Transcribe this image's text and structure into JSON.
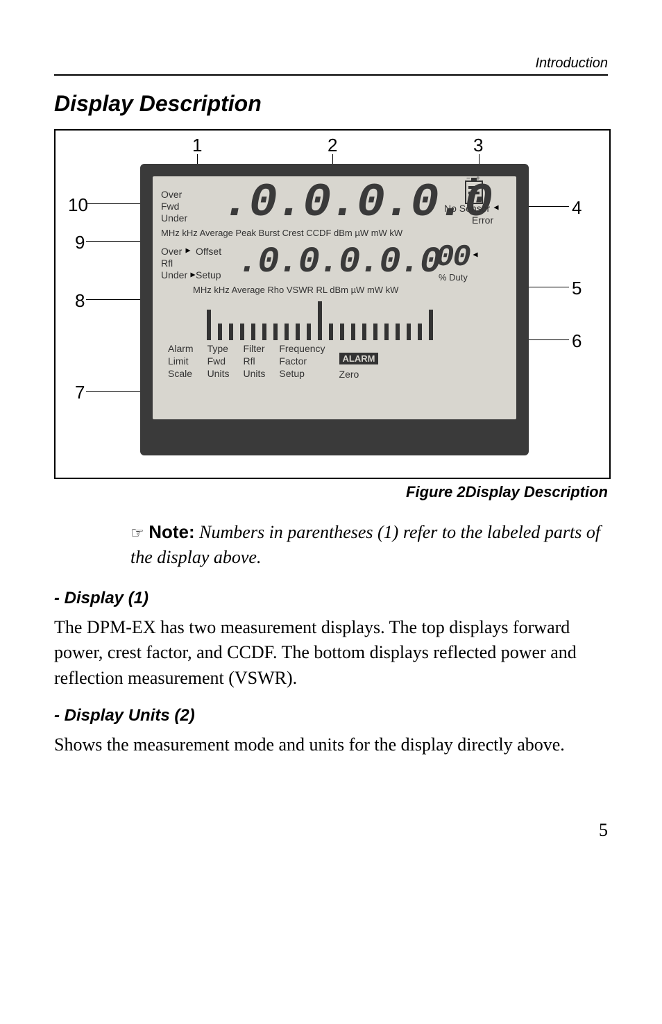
{
  "header": {
    "right": "Introduction"
  },
  "section_title": "Display Description",
  "figure": {
    "callouts": [
      "1",
      "2",
      "3",
      "4",
      "5",
      "6",
      "7",
      "8",
      "9",
      "10"
    ],
    "top": {
      "words": {
        "over": "Over",
        "fwd": "Fwd",
        "under": "Under"
      },
      "digits": ".0.0.0.0.0",
      "right": {
        "no_sensor": "No Sensor",
        "error": "Error"
      },
      "units_strip": "MHz kHz Average Peak Burst Crest CCDF dBm µW mW kW"
    },
    "bottom": {
      "words": {
        "over": "Over",
        "offset": "Offset",
        "rfl": "Rfl",
        "under": "Under",
        "setup": "Setup"
      },
      "digits": ".0.0.0.0.0",
      "duty_digits": "00",
      "duty_label": "% Duty",
      "units_strip": "MHz kHz Average Rho VSWR RL dBm µW mW kW"
    },
    "battery": {
      "minus": "−",
      "plus": "+"
    },
    "menu": {
      "col1": [
        "Alarm",
        "Limit",
        "Scale"
      ],
      "col2": [
        "Type",
        "Fwd",
        "Units"
      ],
      "col3": [
        "Filter",
        "Rfl",
        "Units"
      ],
      "col4": [
        "Frequency",
        "Factor",
        "Setup"
      ],
      "col5_top": "ALARM",
      "col5_bottom": "Zero"
    },
    "caption": "Figure 2Display Description"
  },
  "note": {
    "icon": "☞",
    "label": "Note:",
    "text": "Numbers in parentheses (1) refer to the labeled parts of the display above."
  },
  "subsections": [
    {
      "heading": "- Display (1)",
      "body": "The DPM-EX has two measurement displays. The top displays forward power, crest factor, and CCDF. The bottom displays reflected power and reflection mea­surement (VSWR)."
    },
    {
      "heading": "- Display Units (2)",
      "body": "Shows the measurement mode and units for the dis­play directly above."
    }
  ],
  "page_number": "5"
}
